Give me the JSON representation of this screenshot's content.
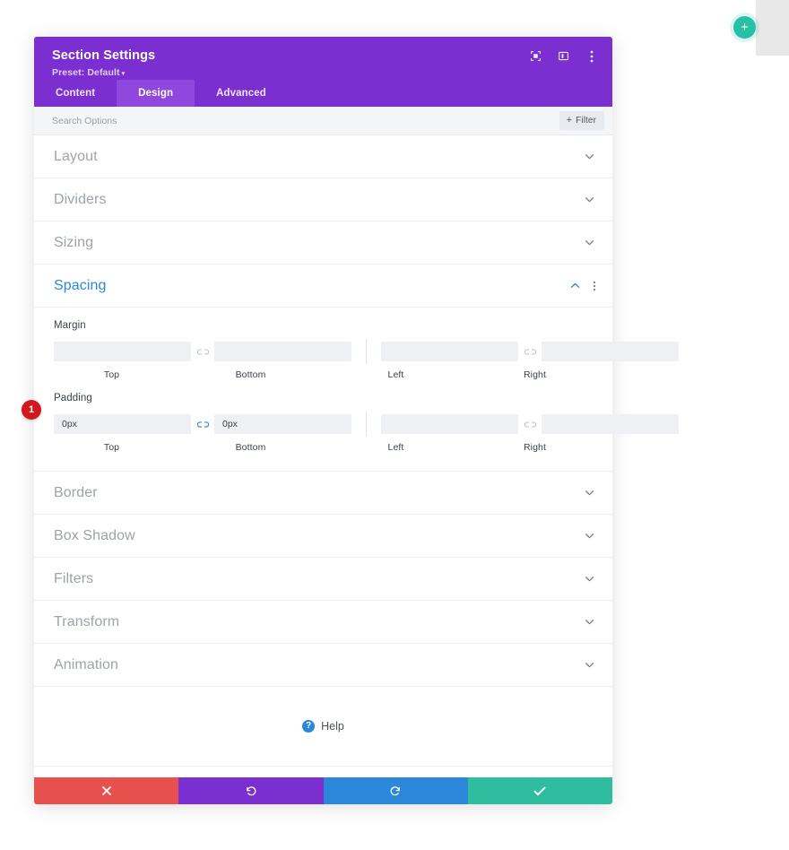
{
  "canvas": {
    "add_button_icon": "plus-icon"
  },
  "modal": {
    "title": "Section Settings",
    "preset_label": "Preset: Default",
    "preset_caret": "▾",
    "header_icons": [
      {
        "name": "focus-target-icon"
      },
      {
        "name": "split-view-icon"
      },
      {
        "name": "more-options-icon"
      }
    ],
    "tabs": [
      {
        "label": "Content",
        "active": false
      },
      {
        "label": "Design",
        "active": true
      },
      {
        "label": "Advanced",
        "active": false
      }
    ],
    "search": {
      "placeholder": "Search Options",
      "value": ""
    },
    "filter_button": {
      "label": "Filter",
      "plus": "+"
    },
    "sections_before": [
      {
        "label": "Layout",
        "open": false
      },
      {
        "label": "Dividers",
        "open": false
      },
      {
        "label": "Sizing",
        "open": false
      }
    ],
    "spacing": {
      "label": "Spacing",
      "open": true,
      "margin": {
        "title": "Margin",
        "top": {
          "value": "",
          "label": "Top"
        },
        "bottom": {
          "value": "",
          "label": "Bottom"
        },
        "left": {
          "value": "",
          "label": "Left"
        },
        "right": {
          "value": "",
          "label": "Right"
        },
        "link_tb_active": false,
        "link_lr_active": false
      },
      "padding": {
        "title": "Padding",
        "top": {
          "value": "0px",
          "label": "Top"
        },
        "bottom": {
          "value": "0px",
          "label": "Bottom"
        },
        "left": {
          "value": "",
          "label": "Left"
        },
        "right": {
          "value": "",
          "label": "Right"
        },
        "link_tb_active": true,
        "link_lr_active": false,
        "badge": "1"
      }
    },
    "sections_after": [
      {
        "label": "Border",
        "open": false
      },
      {
        "label": "Box Shadow",
        "open": false
      },
      {
        "label": "Filters",
        "open": false
      },
      {
        "label": "Transform",
        "open": false
      },
      {
        "label": "Animation",
        "open": false
      }
    ],
    "help": {
      "label": "Help",
      "icon_glyph": "?"
    },
    "footer_buttons": [
      {
        "name": "cancel-button",
        "icon": "close-icon",
        "color": "#e8504e"
      },
      {
        "name": "undo-button",
        "icon": "undo-icon",
        "color": "#7b2fd0"
      },
      {
        "name": "redo-button",
        "icon": "redo-icon",
        "color": "#2b87da"
      },
      {
        "name": "save-button",
        "icon": "check-icon",
        "color": "#2fbda0"
      }
    ]
  },
  "colors": {
    "header_purple": "#7b2fd0",
    "tab_active_purple": "#8f47dd",
    "accent_blue": "#2b87da",
    "badge_red": "#d2181f",
    "save_green": "#2fbda0",
    "cancel_red": "#e8504e",
    "add_teal": "#27bfa5"
  }
}
